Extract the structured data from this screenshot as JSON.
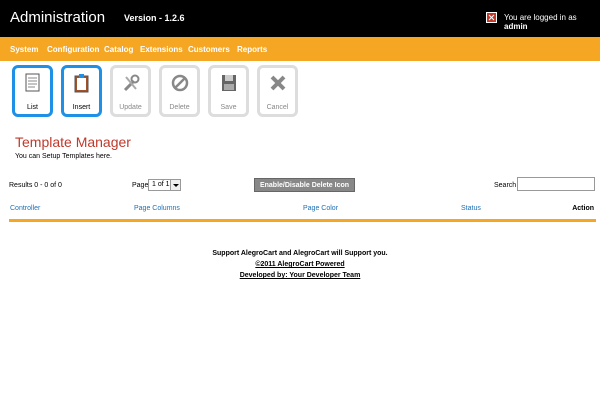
{
  "header": {
    "title": "Administration",
    "version": "Version - 1.2.6",
    "login_prefix": "You are logged in as",
    "user": "admin"
  },
  "menu": [
    {
      "label": "System"
    },
    {
      "label": "Configuration"
    },
    {
      "label": "Catalog"
    },
    {
      "label": "Extensions"
    },
    {
      "label": "Customers"
    },
    {
      "label": "Reports"
    }
  ],
  "toolbar": {
    "list": "List",
    "insert": "Insert",
    "update": "Update",
    "delete": "Delete",
    "save": "Save",
    "cancel": "Cancel"
  },
  "page": {
    "title": "Template Manager",
    "subtitle": "You can Setup Templates here."
  },
  "controls": {
    "results": "Results 0 - 0 of 0",
    "page_label": "Page",
    "page_value": "1 of 1",
    "toggle_button": "Enable/Disable Delete Icon",
    "search_label": "Search",
    "search_value": ""
  },
  "table": {
    "columns": [
      "Controller",
      "Page Columns",
      "Page Color",
      "Status",
      "Action"
    ]
  },
  "footer": {
    "line1": "Support AlegroCart and AlegroCart will Support you.",
    "line2": "©2011 AlegroCart Powered",
    "line3": "Developed by: Your Developer Team"
  },
  "colors": {
    "menu_bg": "#f5a623",
    "active_button": "#1e90e6",
    "heading": "#c0392b",
    "link": "#1e6fb5"
  }
}
